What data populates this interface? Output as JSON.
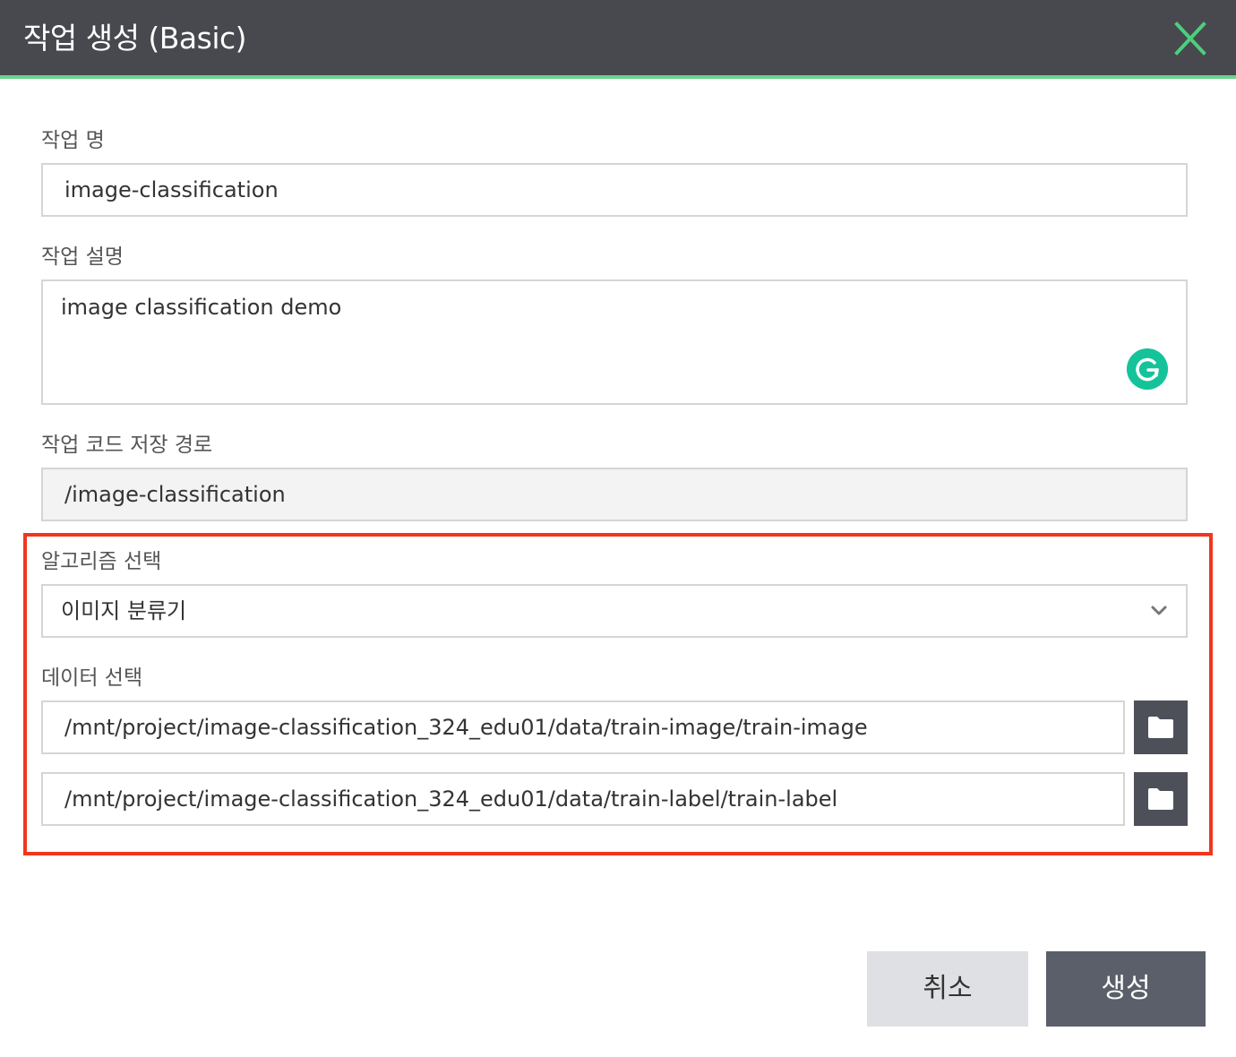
{
  "dialog": {
    "title": "작업 생성 (Basic)"
  },
  "form": {
    "job_name": {
      "label": "작업 명",
      "value": "image-classification"
    },
    "job_description": {
      "label": "작업 설명",
      "value": "image classification demo"
    },
    "code_path": {
      "label": "작업 코드 저장 경로",
      "value": "/image-classification"
    },
    "algorithm": {
      "label": "알고리즘 선택",
      "selected": "이미지 분류기"
    },
    "data": {
      "label": "데이터 선택",
      "paths": [
        "/mnt/project/image-classification_324_edu01/data/train-image/train-image",
        "/mnt/project/image-classification_324_edu01/data/train-label/train-label"
      ]
    }
  },
  "buttons": {
    "cancel": "취소",
    "create": "생성"
  },
  "colors": {
    "header_bg": "#48494e",
    "header_accent": "#6bd38d",
    "close_icon": "#4ccf7e",
    "highlight_border": "#f2361d",
    "grammarly": "#15c39a",
    "folder_button_bg": "#4d5059",
    "create_button_bg": "#5b5f6a",
    "cancel_button_bg": "#dfe0e4"
  },
  "icons": [
    "close-icon",
    "grammarly-icon",
    "chevron-down-icon",
    "folder-icon"
  ]
}
